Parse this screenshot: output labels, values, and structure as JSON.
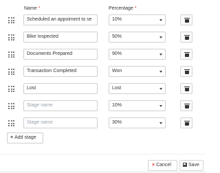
{
  "headers": {
    "name": "Name",
    "percentage": "Percentage",
    "required_mark": "*"
  },
  "stages": [
    {
      "name": "Scheduled an appoiment to se",
      "placeholder": "",
      "percentage": "10%"
    },
    {
      "name": "Bike Inspected",
      "placeholder": "",
      "percentage": "50%"
    },
    {
      "name": "Documents Prepared",
      "placeholder": "",
      "percentage": "90%"
    },
    {
      "name": "Transaction Completed",
      "placeholder": "",
      "percentage": "Won"
    },
    {
      "name": "Lost",
      "placeholder": "",
      "percentage": "Lost"
    },
    {
      "name": "",
      "placeholder": "Stage name",
      "percentage": "10%"
    },
    {
      "name": "",
      "placeholder": "Stage name",
      "percentage": "30%"
    }
  ],
  "actions": {
    "add_stage": "Add stage",
    "add_icon": "+",
    "cancel": "Cancel",
    "cancel_icon": "×",
    "save": "Save"
  },
  "icons": {
    "drag": "drag-grip-icon",
    "delete": "trash-icon",
    "dropdown": "caret-down-icon",
    "save": "floppy-disk-icon"
  },
  "colors": {
    "required": "#e53935",
    "cancel_icon": "#e53935",
    "border": "#cfcfcf",
    "placeholder": "#9aa3ad"
  }
}
